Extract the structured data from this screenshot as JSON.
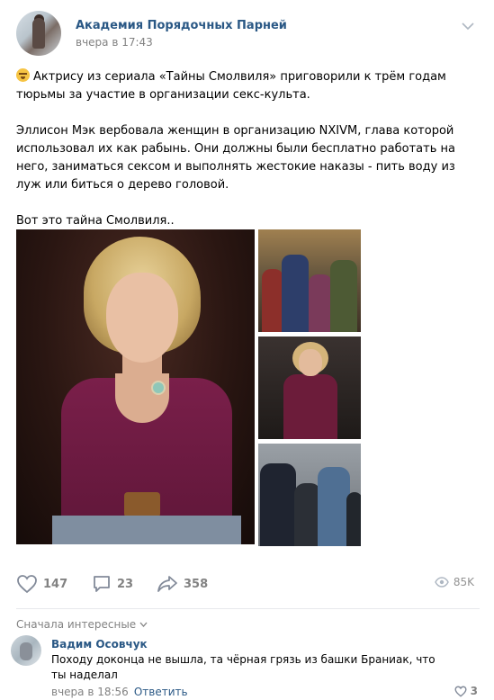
{
  "post": {
    "group_name": "Академия Порядочных Парней",
    "time": "вчера в 17:43",
    "paragraphs": [
      "Актрису из сериала «Тайны Смолвиля» приговорили к трём годам тюрьмы за участие в организации секс-культа.",
      "Эллисон Мэк вербовала женщин в организацию NXIVM, глава которой использовал их как рабынь. Они должны были бесплатно работать на него, заниматься сексом и выполнять жестокие наказы - пить воду из луж или биться о дерево головой.",
      "Вот это тайна Смолвиля.."
    ],
    "emoji_icon": "grinning-face-emoji"
  },
  "actions": {
    "likes": "147",
    "comments": "23",
    "shares": "358",
    "views": "85K"
  },
  "comments_section": {
    "sort_label": "Сначала интересные",
    "items": [
      {
        "author": "Вадим Осовчук",
        "text": "Походу доконца не вышла, та чёрная грязь из башки Браниак, что ты наделал",
        "time": "вчера в 18:56",
        "reply_label": "Ответить",
        "likes": "3"
      }
    ]
  },
  "colors": {
    "link": "#2a5885",
    "muted": "#828282",
    "divider": "#e7e8ec"
  }
}
